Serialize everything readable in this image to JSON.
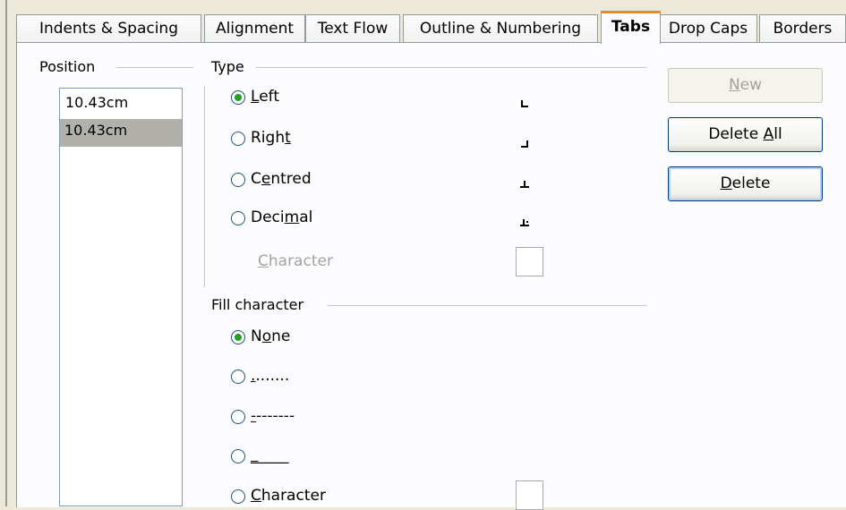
{
  "tabs": [
    {
      "label": "Indents & Spacing",
      "active": false
    },
    {
      "label": "Alignment",
      "active": false
    },
    {
      "label": "Text Flow",
      "active": false
    },
    {
      "label": "Outline & Numbering",
      "active": false
    },
    {
      "label": "Tabs",
      "active": true
    },
    {
      "label": "Drop Caps",
      "active": false
    },
    {
      "label": "Borders",
      "active": false
    }
  ],
  "position": {
    "header": "Position",
    "input_value": "10.43cm",
    "list": [
      "10.43cm"
    ]
  },
  "type": {
    "header": "Type",
    "options": [
      {
        "before": "",
        "key": "L",
        "after": "eft",
        "checked": true,
        "icon": "left-tab-icon"
      },
      {
        "before": "Righ",
        "key": "t",
        "after": "",
        "checked": false,
        "icon": "right-tab-icon"
      },
      {
        "before": "C",
        "key": "e",
        "after": "ntred",
        "checked": false,
        "icon": "centred-tab-icon"
      },
      {
        "before": "Deci",
        "key": "m",
        "after": "al",
        "checked": false,
        "icon": "decimal-tab-icon"
      }
    ],
    "character_label": {
      "before": "",
      "key": "C",
      "after": "haracter"
    },
    "character_value": ""
  },
  "fill": {
    "header": "Fill character",
    "options": [
      {
        "before": "N",
        "key": "o",
        "after": "ne",
        "checked": true
      },
      {
        "before": "",
        "key": ".",
        "after": ".......",
        "checked": false
      },
      {
        "before": "",
        "key": "-",
        "after": "-------",
        "checked": false
      },
      {
        "before": "",
        "key": "_",
        "after": "____",
        "checked": false
      },
      {
        "before": "",
        "key": "C",
        "after": "haracter",
        "checked": false
      }
    ],
    "character_value": ""
  },
  "buttons": {
    "new": {
      "before": "",
      "key": "N",
      "after": "ew"
    },
    "delete_all": {
      "before": "Delete ",
      "key": "A",
      "after": "ll"
    },
    "delete": {
      "before": "",
      "key": "D",
      "after": "elete"
    }
  }
}
